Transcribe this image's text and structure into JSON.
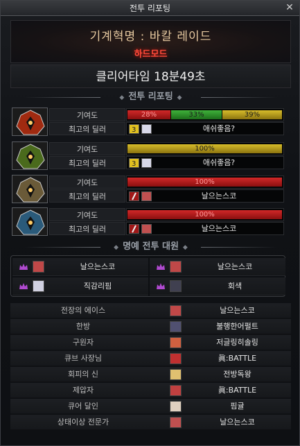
{
  "window": {
    "title": "전투 리포팅",
    "close_label": "✕"
  },
  "raid": {
    "name": "기계혁명 : 바칼 레이드",
    "difficulty": "하드모드"
  },
  "clear": {
    "text": "클리어타임  18분49초"
  },
  "report_header": "전투 리포팅",
  "honor_header": "명예 전투 대원",
  "bosses": [
    {
      "contribution_label": "기여도",
      "dealer_label": "최고의 딜러",
      "bars": [
        {
          "color": "red",
          "value": 28,
          "label": "28%"
        },
        {
          "color": "green",
          "value": 33,
          "label": "33%"
        },
        {
          "color": "yellow",
          "value": 39,
          "label": "39%"
        }
      ],
      "dealer_name": "애쉬좋음?",
      "dealer_icon": "yellow-3-class-icon",
      "portrait_color": "#a02a10"
    },
    {
      "contribution_label": "기여도",
      "dealer_label": "최고의 딜러",
      "bars": [
        {
          "color": "yellow",
          "value": 100,
          "label": "100%"
        }
      ],
      "dealer_name": "애쉬좋음?",
      "dealer_icon": "yellow-3-class-icon",
      "portrait_color": "#4a6a1c"
    },
    {
      "contribution_label": "기여도",
      "dealer_label": "최고의 딜러",
      "bars": [
        {
          "color": "red",
          "value": 100,
          "label": "100%"
        }
      ],
      "dealer_name": "날으는스코",
      "dealer_icon": "red-blade-class-icon",
      "portrait_color": "#6a5a38"
    },
    {
      "contribution_label": "기여도",
      "dealer_label": "최고의 딜러",
      "bars": [
        {
          "color": "red",
          "value": 100,
          "label": "100%"
        }
      ],
      "dealer_name": "날으는스코",
      "dealer_icon": "red-blade-class-icon",
      "portrait_color": "#2a5a7a"
    }
  ],
  "honor_members": [
    {
      "name": "날으는스코",
      "avatar": "red-hair-avatar"
    },
    {
      "name": "날으는스코",
      "avatar": "red-hair-avatar"
    },
    {
      "name": "직감리핌",
      "avatar": "white-hair-avatar"
    },
    {
      "name": "회색",
      "avatar": "dark-hair-avatar"
    }
  ],
  "awards": [
    {
      "title": "전장의 에이스",
      "name": "날으는스코"
    },
    {
      "title": "한방",
      "name": "불행한어펄트"
    },
    {
      "title": "구원자",
      "name": "저글링히솔링"
    },
    {
      "title": "큐브 사장님",
      "name": "眞:BATTLE"
    },
    {
      "title": "회피의 신",
      "name": "전방독왕"
    },
    {
      "title": "제압자",
      "name": "眞:BATTLE"
    },
    {
      "title": "큐어 달인",
      "name": "핌귤"
    },
    {
      "title": "상태이상 전문가",
      "name": "날으는스코"
    }
  ],
  "colors": {
    "red": "#d22828",
    "green": "#3fb23a",
    "yellow": "#d8bd2a",
    "accent_title": "#e6c9a0",
    "hard_mode": "#ff4a3a"
  }
}
